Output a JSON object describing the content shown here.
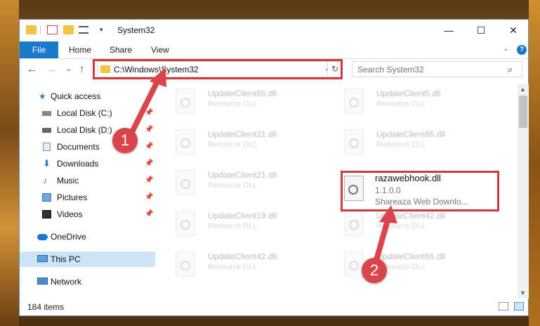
{
  "window": {
    "title": "System32",
    "minimize": "—",
    "maximize": "☐",
    "close": "✕"
  },
  "ribbon": {
    "tabs": [
      "File",
      "Home",
      "Share",
      "View"
    ],
    "help": "?"
  },
  "nav": {
    "back": "←",
    "forward": "→",
    "recent": "⌄",
    "up": "↑",
    "address": "C:\\Windows\\System32",
    "refresh": "↻",
    "search_placeholder": "Search System32"
  },
  "sidebar": {
    "items": [
      {
        "label": "Quick access",
        "icon": "star-icon",
        "pinned": false
      },
      {
        "label": "Local Disk (C:)",
        "icon": "drive-icon",
        "pinned": true
      },
      {
        "label": "Local Disk (D:)",
        "icon": "drive-icon",
        "pinned": true
      },
      {
        "label": "Documents",
        "icon": "documents-icon",
        "pinned": true
      },
      {
        "label": "Downloads",
        "icon": "download-icon",
        "pinned": true
      },
      {
        "label": "Music",
        "icon": "music-icon",
        "pinned": true
      },
      {
        "label": "Pictures",
        "icon": "pictures-icon",
        "pinned": true
      },
      {
        "label": "Videos",
        "icon": "videos-icon",
        "pinned": true
      },
      {
        "label": "OneDrive",
        "icon": "cloud-icon",
        "pinned": false
      },
      {
        "label": "This PC",
        "icon": "computer-icon",
        "pinned": false,
        "selected": true
      },
      {
        "label": "Network",
        "icon": "network-icon",
        "pinned": false
      }
    ]
  },
  "files": [
    {
      "name": "UpdateClient65.dll",
      "desc": "Resource DLL"
    },
    {
      "name": "UpdateClient5.dll",
      "desc": "Resource DLL"
    },
    {
      "name": "UpdateClient21.dll",
      "desc": "Resource DLL"
    },
    {
      "name": "UpdateClient65.dll",
      "desc": "Resource DLL"
    },
    {
      "name": "UpdateClient21.dll",
      "desc": "Resource DLL"
    },
    {
      "name": "UpdateClient19.dll",
      "desc": "Resource DLL"
    },
    {
      "name": "UpdateClient42.dll",
      "desc": "Resource DLL"
    },
    {
      "name": "UpdateClient42.dll",
      "desc": "Resource DLL"
    },
    {
      "name": "UpdateClient65.dll",
      "desc": "Resource DLL"
    }
  ],
  "highlighted_file": {
    "name": "razawebhook.dll",
    "version": "1.1.0.0",
    "desc": "Shareaza Web Downlo..."
  },
  "status": {
    "count": "184 items"
  },
  "annotations": {
    "step1": "1",
    "step2": "2",
    "highlight_color": "#d23a3a"
  }
}
